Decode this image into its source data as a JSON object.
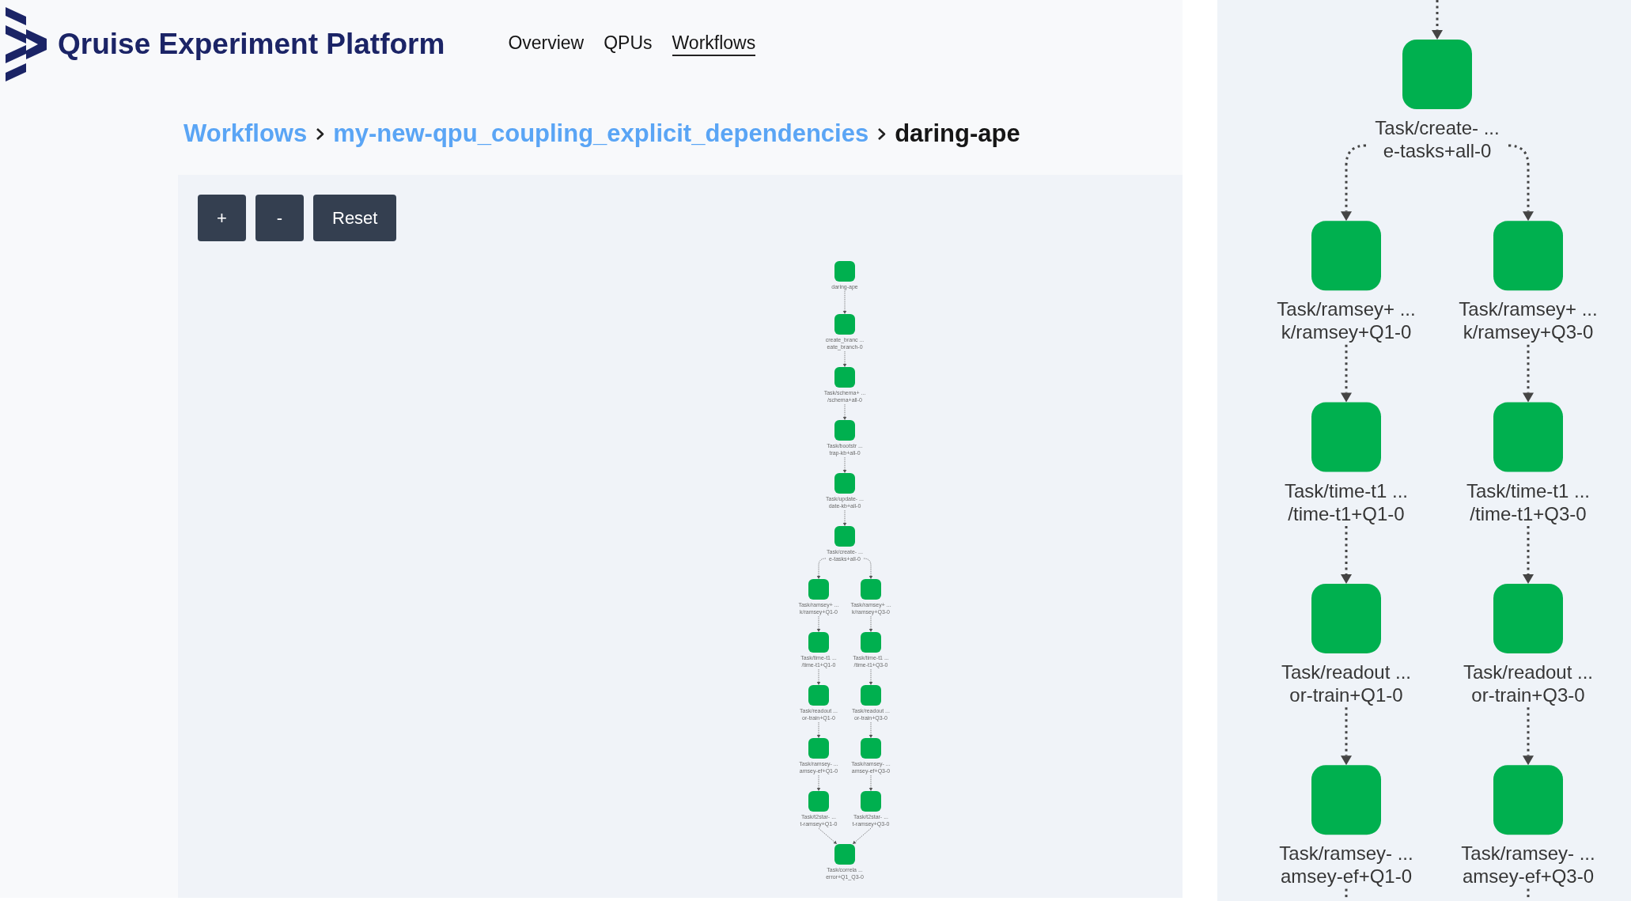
{
  "header": {
    "title": "Qruise Experiment Platform",
    "nav": [
      {
        "label": "Overview",
        "selected": false
      },
      {
        "label": "QPUs",
        "selected": false
      },
      {
        "label": "Workflows",
        "selected": true
      }
    ]
  },
  "breadcrumb": [
    {
      "label": "Workflows",
      "kind": "link"
    },
    {
      "label": "my-new-qpu_coupling_explicit_dependencies",
      "kind": "link"
    },
    {
      "label": "daring-ape",
      "kind": "current"
    }
  ],
  "graph_controls": [
    "+",
    "-",
    "Reset"
  ],
  "workflow_graph": {
    "rows": [
      {
        "nodes": [
          {
            "label": [
              "daring-ape"
            ]
          }
        ]
      },
      {
        "nodes": [
          {
            "label": [
              "create_branc ...",
              "eate_branch-0"
            ]
          }
        ]
      },
      {
        "nodes": [
          {
            "label": [
              "Task/schema+ ...",
              "/schema+all-0"
            ]
          }
        ]
      },
      {
        "nodes": [
          {
            "label": [
              "Task/bootstr ...",
              "trap-kb+all-0"
            ]
          }
        ]
      },
      {
        "nodes": [
          {
            "label": [
              "Task/update- ...",
              "date-kb+all-0"
            ]
          }
        ]
      },
      {
        "nodes": [
          {
            "label": [
              "Task/create- ...",
              "e-tasks+all-0"
            ]
          }
        ]
      },
      {
        "nodes": [
          {
            "label": [
              "Task/ramsey+ ...",
              "k/ramsey+Q1-0"
            ]
          },
          {
            "label": [
              "Task/ramsey+ ...",
              "k/ramsey+Q3-0"
            ]
          }
        ]
      },
      {
        "nodes": [
          {
            "label": [
              "Task/time-t1 ...",
              "/time-t1+Q1-0"
            ]
          },
          {
            "label": [
              "Task/time-t1 ...",
              "/time-t1+Q3-0"
            ]
          }
        ]
      },
      {
        "nodes": [
          {
            "label": [
              "Task/readout ...",
              "or-train+Q1-0"
            ]
          },
          {
            "label": [
              "Task/readout ...",
              "or-train+Q3-0"
            ]
          }
        ]
      },
      {
        "nodes": [
          {
            "label": [
              "Task/ramsey- ...",
              "amsey-ef+Q1-0"
            ]
          },
          {
            "label": [
              "Task/ramsey- ...",
              "amsey-ef+Q3-0"
            ]
          }
        ]
      },
      {
        "nodes": [
          {
            "label": [
              "Task/t2star- ...",
              "t-ramsey+Q1-0"
            ]
          },
          {
            "label": [
              "Task/t2star- ...",
              "t-ramsey+Q3-0"
            ]
          }
        ]
      },
      {
        "nodes": [
          {
            "label": [
              "Task/correla ...",
              "error+Q1_Q3-0"
            ]
          }
        ]
      }
    ]
  },
  "detail_view": {
    "continues_above": true,
    "continues_below": true,
    "rows": [
      {
        "nodes": [
          {
            "label": [
              "Task/create- ...",
              "e-tasks+all-0"
            ]
          }
        ]
      },
      {
        "nodes": [
          {
            "label": [
              "Task/ramsey+ ...",
              "k/ramsey+Q1-0"
            ]
          },
          {
            "label": [
              "Task/ramsey+ ...",
              "k/ramsey+Q3-0"
            ]
          }
        ]
      },
      {
        "nodes": [
          {
            "label": [
              "Task/time-t1 ...",
              "/time-t1+Q1-0"
            ]
          },
          {
            "label": [
              "Task/time-t1 ...",
              "/time-t1+Q3-0"
            ]
          }
        ]
      },
      {
        "nodes": [
          {
            "label": [
              "Task/readout ...",
              "or-train+Q1-0"
            ]
          },
          {
            "label": [
              "Task/readout ...",
              "or-train+Q3-0"
            ]
          }
        ]
      },
      {
        "nodes": [
          {
            "label": [
              "Task/ramsey- ...",
              "amsey-ef+Q1-0"
            ]
          },
          {
            "label": [
              "Task/ramsey- ...",
              "amsey-ef+Q3-0"
            ]
          }
        ]
      }
    ]
  }
}
